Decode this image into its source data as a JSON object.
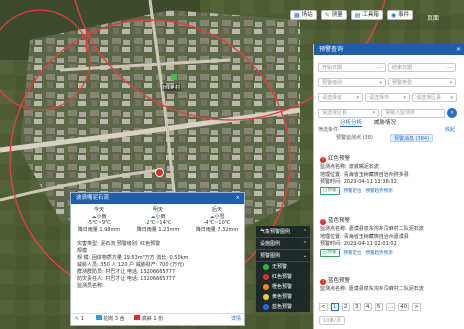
{
  "topbar": {
    "home": "页面",
    "layer_btn": "场站",
    "measure_btn": "测量",
    "tools_btn": "工具箱",
    "alert_btn": "事件"
  },
  "map": {
    "marker_label": "H1乡村",
    "colors": {
      "road": "#d9d2c4",
      "circle": "#e04040"
    }
  },
  "right_panel": {
    "title": "预警查询",
    "close": "×",
    "fields": [
      {
        "placeholder": "开始日期",
        "suffix": "—"
      },
      {
        "placeholder": "结束日期",
        "suffix": "—"
      },
      {
        "placeholder": "预警级别",
        "suffix": "▾"
      },
      {
        "placeholder": "预警类型",
        "suffix": "▾"
      },
      {
        "placeholder": "请选择省",
        "suffix": "▾"
      },
      {
        "placeholder": "请选择市",
        "suffix": "▾"
      },
      {
        "placeholder": "请选择区县",
        "suffix": "▾"
      },
      {
        "placeholder": "请输入监测点",
        "suffix": ""
      }
    ],
    "tabs": [
      "分析分析",
      "威胁情况"
    ],
    "filter_label": "筛选条件",
    "filter_more": "收起",
    "pill_a": "预警监测点 (38)",
    "pill_b": "预警消息 (384)",
    "alerts": [
      {
        "title": "红色预警",
        "site_label": "监测点名称:",
        "site": "波浪嘴泥石流",
        "addr_label": "地理位置:",
        "addr": "青海省玉树藏族自治州称多县",
        "time_label": "预警时间:",
        "time": "2023-04-11 13:38:32",
        "btn": "已预警",
        "link1": "预警定位",
        "link2": "预警趋势预测"
      },
      {
        "title": "蓝色预警",
        "site_label": "监测点名称:",
        "site": "嘉漠县泉东沟乡尕麻村二队泥石流",
        "addr_label": "地理位置:",
        "addr": "青海省玉树藏族自治州嘉漠县",
        "time_label": "预警时间:",
        "time": "2023-04-11 02:01:02",
        "btn": "已预警",
        "link1": "预警定位",
        "link2": "预警趋势预测"
      },
      {
        "title": "蓝色预警",
        "site_label": "监测点名称:",
        "site": "嘉漠县泉东沟乡尕麻村二队泥石流",
        "addr_label": "地理位置:",
        "addr": "",
        "time_label": "",
        "time": "",
        "btn": "",
        "link1": "",
        "link2": ""
      }
    ],
    "pager": {
      "prev": "<",
      "pages": [
        "1",
        "2",
        "3",
        "4",
        "5",
        "…",
        "40"
      ],
      "next": ">",
      "page_size": "10条/页"
    }
  },
  "popup": {
    "title": "波浪嘴泥石流",
    "close": "×",
    "weather": [
      {
        "day": "今天",
        "desc": "小雨",
        "temp": "-5℃~9℃",
        "rain": "降日雨量 1.98mm"
      },
      {
        "day": "明天",
        "desc": "小雨",
        "temp": "-2℃~14℃",
        "rain": "降日雨量 1.23mm"
      },
      {
        "day": "后天",
        "desc": "小雪",
        "temp": "-4℃~10℃",
        "rain": "降日雨量 7.32mm"
      }
    ],
    "info": [
      "灾害类型:  泥石流          预警级别:  红色预警",
      "规模",
      "规     模:  固体物质方量 19.53m³万方  流长: 0.50km",
      "威胁人员: 350 人 120 户      威胁财产:  700 (万元)",
      "群测群防员:  村巴才让      电话:  13206665777",
      "防灾责任人:  村巴才让      电话:  13206665777",
      "监测员名称:  "
    ],
    "footer": {
      "c1": "1",
      "c1l": "花岗",
      "c2": "3",
      "c2l": "含",
      "c3l": "高斜",
      "c3": "1 份",
      "link": "详情"
    }
  },
  "legend": {
    "headers": [
      "气象预警图例",
      "设施图例",
      "预警图例"
    ],
    "items": [
      {
        "label": "无预警",
        "color": "#2db23d"
      },
      {
        "label": "红色预警",
        "color": "#e02b2b"
      },
      {
        "label": "橙色预警",
        "color": "#f08a1d"
      },
      {
        "label": "黄色预警",
        "color": "#f1d21c"
      },
      {
        "label": "蓝色预警",
        "color": "#2c67e0"
      }
    ]
  }
}
